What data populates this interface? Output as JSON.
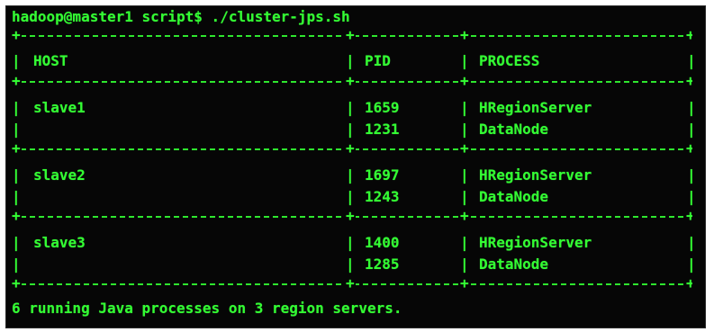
{
  "terminal": {
    "prompt": "hadoop@master1 script$ ./cluster-jps.sh",
    "table": {
      "headers": [
        "HOST",
        "PID",
        "PROCESS"
      ],
      "groups": [
        {
          "host": "slave1",
          "rows": [
            {
              "pid": "1659",
              "process": "HRegionServer"
            },
            {
              "pid": "1231",
              "process": "DataNode"
            }
          ]
        },
        {
          "host": "slave2",
          "rows": [
            {
              "pid": "1697",
              "process": "HRegionServer"
            },
            {
              "pid": "1243",
              "process": "DataNode"
            }
          ]
        },
        {
          "host": "slave3",
          "rows": [
            {
              "pid": "1400",
              "process": "HRegionServer"
            },
            {
              "pid": "1285",
              "process": "DataNode"
            }
          ]
        }
      ]
    },
    "summary": "6 running Java processes on 3 region servers.",
    "colors": {
      "background": "#060606",
      "text": "#33ff33"
    }
  }
}
